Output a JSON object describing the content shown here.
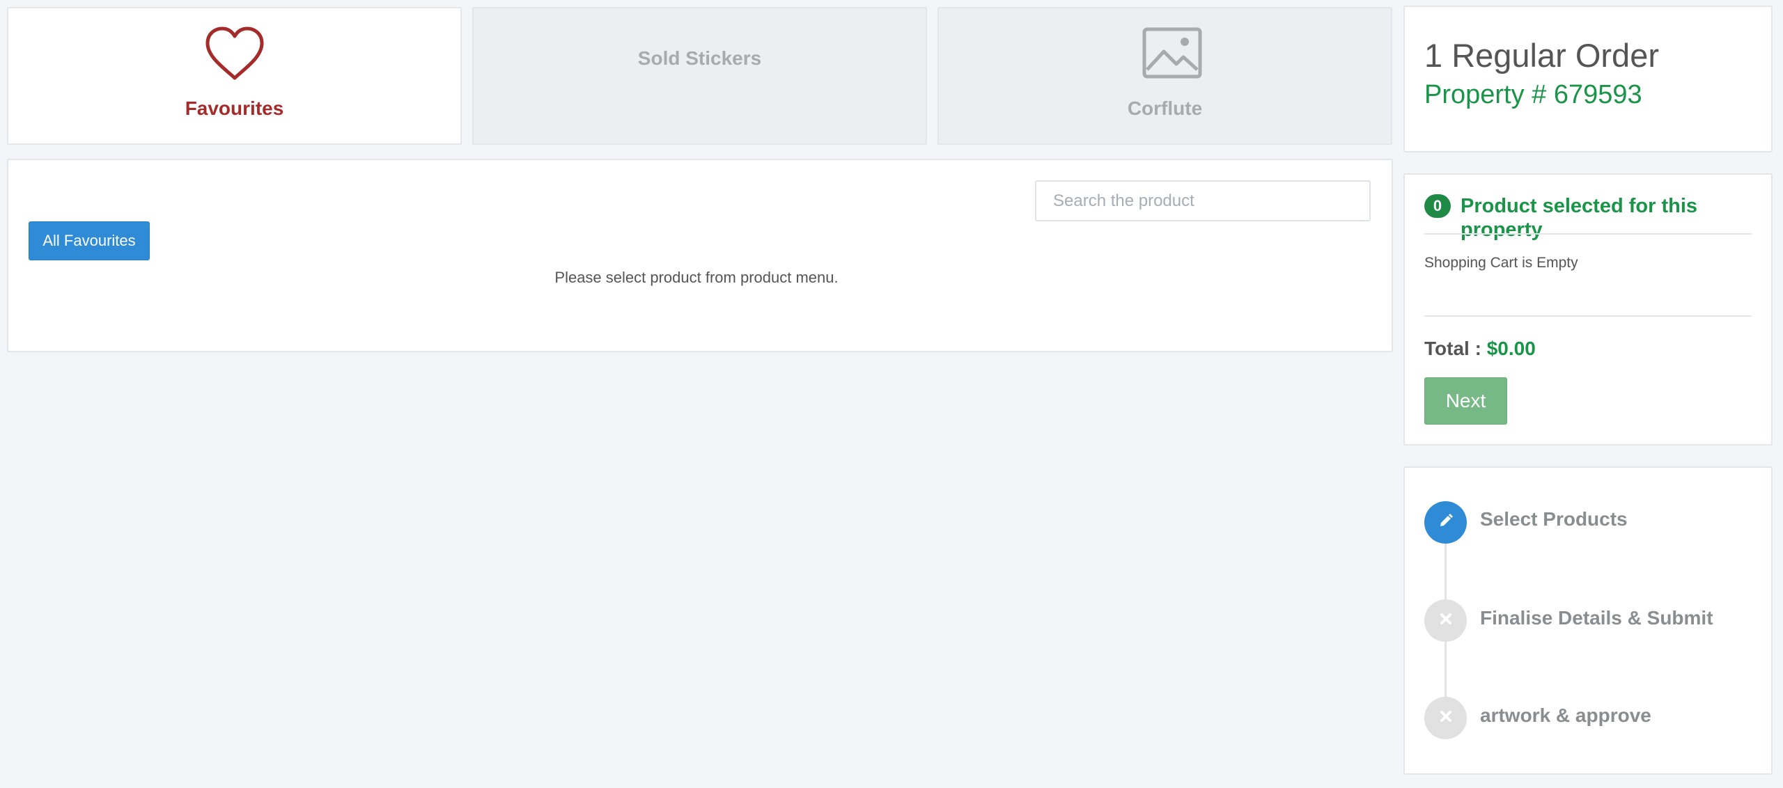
{
  "tabs": [
    {
      "label": "Favourites",
      "icon": "heart-icon",
      "state": "active"
    },
    {
      "label": "Sold Stickers",
      "icon": "",
      "state": "inactive"
    },
    {
      "label": "Corflute",
      "icon": "image-icon",
      "state": "inactive"
    }
  ],
  "main": {
    "search_placeholder": "Search the product",
    "all_favourites_label": "All Favourites",
    "empty_message": "Please select product from product menu."
  },
  "order": {
    "title": "1 Regular Order",
    "property": "Property # 679593"
  },
  "cart": {
    "count": "0",
    "heading": "Product selected for this property",
    "empty_text": "Shopping Cart is Empty",
    "total_label": "Total :",
    "total_value": "$0.00",
    "next_label": "Next"
  },
  "steps": [
    {
      "label": "Select Products",
      "icon": "pencil-icon",
      "state": "active"
    },
    {
      "label": "Finalise Details & Submit",
      "icon": "close-icon",
      "state": "pending"
    },
    {
      "label": "artwork & approve",
      "icon": "close-icon",
      "state": "pending"
    }
  ],
  "colors": {
    "accent_blue": "#2f8bd6",
    "accent_green": "#1a9448",
    "favourite_red": "#a52a2a",
    "next_green": "#76b987"
  }
}
